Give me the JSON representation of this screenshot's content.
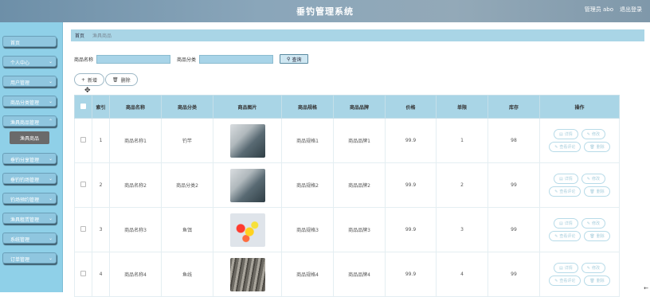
{
  "header": {
    "title": "垂钓管理系统",
    "user_label": "管理员",
    "username": "abo",
    "logout_label": "退出登录"
  },
  "sidebar": {
    "items": [
      {
        "label": "首页",
        "expandable": false
      },
      {
        "label": "个人中心",
        "expandable": true
      },
      {
        "label": "用户管理",
        "expandable": true
      },
      {
        "label": "商品分类管理",
        "expandable": true
      },
      {
        "label": "渔具商品管理",
        "expandable": true,
        "expanded": true
      },
      {
        "label": "垂钓分享管理",
        "expandable": true
      },
      {
        "label": "垂钓钓场管理",
        "expandable": true
      },
      {
        "label": "钓场预约管理",
        "expandable": true
      },
      {
        "label": "渔具租赁管理",
        "expandable": true
      },
      {
        "label": "系统管理",
        "expandable": true
      },
      {
        "label": "订单管理",
        "expandable": true
      }
    ],
    "sub_item": "渔具商品"
  },
  "breadcrumb": {
    "home": "首页",
    "current": "渔具商品"
  },
  "search": {
    "name_label": "商品名称",
    "name_value": "",
    "category_label": "商品分类",
    "category_value": "",
    "query_label": "查询"
  },
  "actions": {
    "add_label": "新增",
    "delete_label": "删除"
  },
  "table": {
    "headers": [
      "",
      "索引",
      "商品名称",
      "商品分类",
      "商品图片",
      "商品规格",
      "商品品牌",
      "价格",
      "单限",
      "库存",
      "操作"
    ],
    "rows": [
      {
        "index": "1",
        "name": "商品名称1",
        "category": "钓竿",
        "image": "fishing-rod-photo",
        "spec": "商品规格1",
        "brand": "商品品牌1",
        "price": "99.9",
        "limit": "1",
        "stock": "98"
      },
      {
        "index": "2",
        "name": "商品名称2",
        "category": "商品分类2",
        "image": "fishing-rod-photo",
        "spec": "商品规格2",
        "brand": "商品品牌2",
        "price": "99.9",
        "limit": "2",
        "stock": "99"
      },
      {
        "index": "3",
        "name": "商品名称3",
        "category": "鱼饵",
        "image": "fishing-lure-photo",
        "spec": "商品规格3",
        "brand": "商品品牌3",
        "price": "99.9",
        "limit": "3",
        "stock": "99"
      },
      {
        "index": "4",
        "name": "商品名称4",
        "category": "鱼线",
        "image": "fishing-line-photo",
        "spec": "商品规格4",
        "brand": "商品品牌4",
        "price": "99.9",
        "limit": "4",
        "stock": "99"
      }
    ],
    "row_ops": {
      "detail": "详情",
      "edit": "修改",
      "review": "查看评论",
      "delete": "删除"
    }
  }
}
